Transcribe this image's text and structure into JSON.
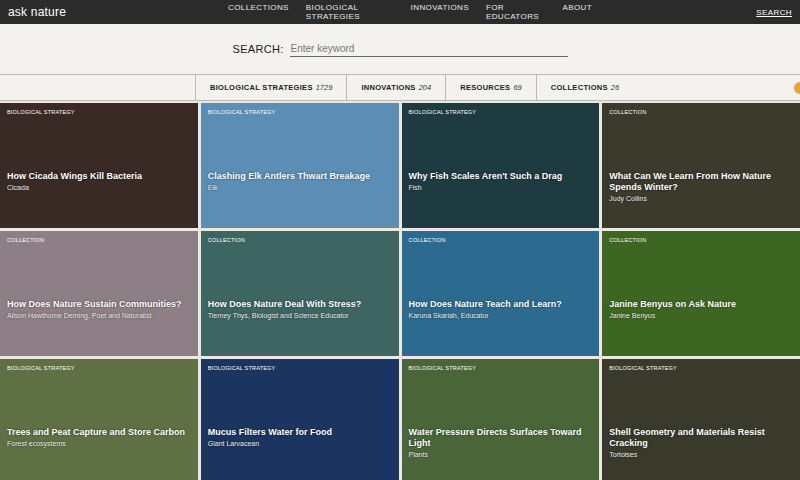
{
  "logo": "ask nature",
  "nav": [
    "COLLECTIONS",
    "BIOLOGICAL STRATEGIES",
    "INNOVATIONS",
    "FOR EDUCATORS",
    "ABOUT"
  ],
  "nav_search": "SEARCH",
  "search": {
    "label": "SEARCH:",
    "placeholder": "Enter keyword"
  },
  "tabs": [
    {
      "label": "BIOLOGICAL STRATEGIES",
      "count": "1729"
    },
    {
      "label": "INNOVATIONS",
      "count": "204"
    },
    {
      "label": "RESOURCES",
      "count": "69"
    },
    {
      "label": "COLLECTIONS",
      "count": "26"
    }
  ],
  "cards": [
    {
      "type": "BIOLOGICAL STRATEGY",
      "title": "How Cicada Wings Kill Bacteria",
      "subtitle": "Cicada",
      "color": "#3a2a25"
    },
    {
      "type": "BIOLOGICAL STRATEGY",
      "title": "Clashing Elk Antlers Thwart Breakage",
      "subtitle": "Elk",
      "color": "#5b8db5"
    },
    {
      "type": "BIOLOGICAL STRATEGY",
      "title": "Why Fish Scales Aren't Such a Drag",
      "subtitle": "Fish",
      "color": "#1f3b42"
    },
    {
      "type": "COLLECTION",
      "title": "What Can We Learn From How Nature Spends Winter?",
      "subtitle": "Judy Collins",
      "color": "#3b3a2c"
    },
    {
      "type": "COLLECTION",
      "title": "How Does Nature Sustain Communities?",
      "subtitle": "Alison Hawthorne Deming, Poet and Naturalist",
      "color": "#8e7f86"
    },
    {
      "type": "COLLECTION",
      "title": "How Does Nature Deal With Stress?",
      "subtitle": "Tierney Thys, Biologist and Science Educator",
      "color": "#3d6663"
    },
    {
      "type": "COLLECTION",
      "title": "How Does Nature Teach and Learn?",
      "subtitle": "Karuna Skariah, Educator",
      "color": "#2d6a8f"
    },
    {
      "type": "COLLECTION",
      "title": "Janine Benyus on Ask Nature",
      "subtitle": "Janine Benyus",
      "color": "#3d6622"
    },
    {
      "type": "BIOLOGICAL STRATEGY",
      "title": "Trees and Peat Capture and Store Carbon",
      "subtitle": "Forest ecosystems",
      "color": "#5f7045"
    },
    {
      "type": "BIOLOGICAL STRATEGY",
      "title": "Mucus Filters Water for Food",
      "subtitle": "Giant Larvacean",
      "color": "#1b3560"
    },
    {
      "type": "BIOLOGICAL STRATEGY",
      "title": "Water Pressure Directs Surfaces Toward Light",
      "subtitle": "Plants",
      "color": "#4a6638"
    },
    {
      "type": "BIOLOGICAL STRATEGY",
      "title": "Shell Geometry and Materials Resist Cracking",
      "subtitle": "Tortoises",
      "color": "#3a3a2c"
    }
  ]
}
